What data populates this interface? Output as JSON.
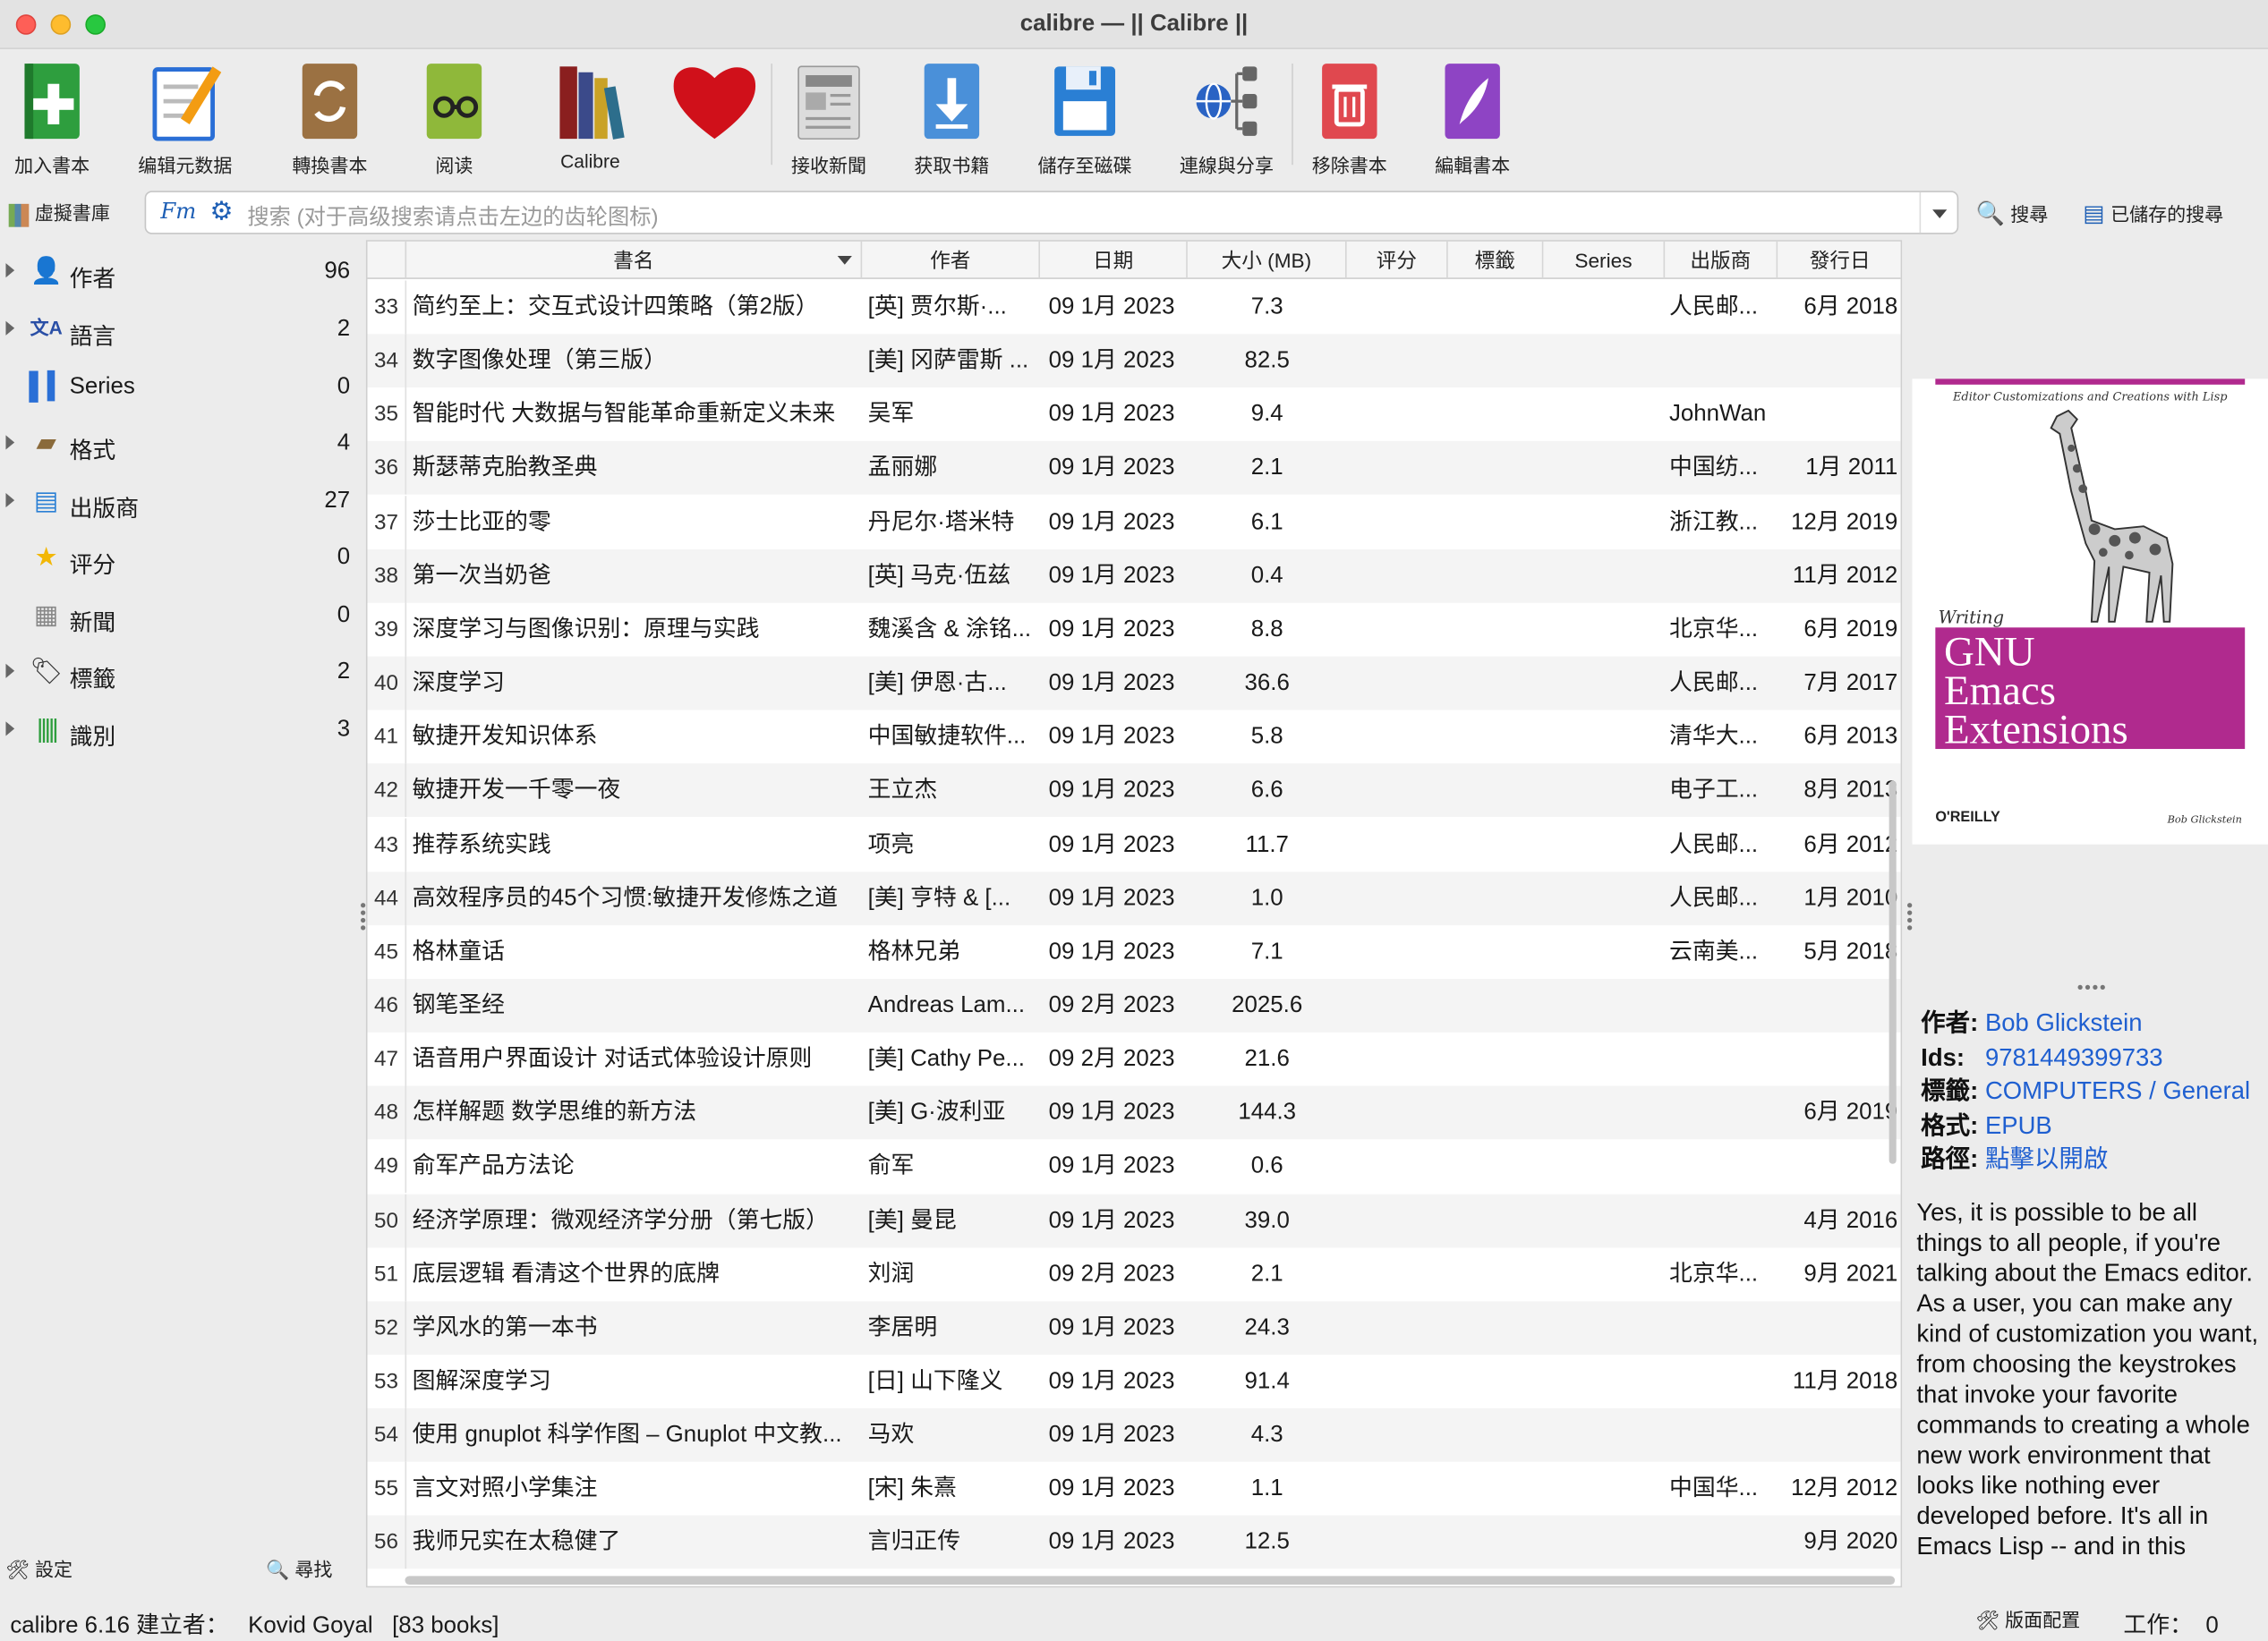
{
  "window": {
    "title": "calibre — || Calibre ||"
  },
  "toolbar": {
    "add": "加入書本",
    "edit_meta": "编辑元数据",
    "convert": "轉換書本",
    "read": "阅读",
    "calibre": "Calibre",
    "fetch_news": "接收新聞",
    "get_books": "获取书籍",
    "save": "儲存至磁碟",
    "connect": "連線與分享",
    "remove": "移除書本",
    "edit_book": "編輯書本"
  },
  "search": {
    "virtual_lib": "虛擬書庫",
    "placeholder": "搜索 (对于高级搜索请点击左边的齿轮图标)",
    "search_btn": "搜尋",
    "saved_btn": "已儲存的搜尋"
  },
  "sidebar": {
    "items": [
      {
        "label": "作者",
        "count": "96",
        "icon": "person-icon"
      },
      {
        "label": "語言",
        "count": "2",
        "icon": "language-icon"
      },
      {
        "label": "Series",
        "count": "0",
        "icon": "series-icon"
      },
      {
        "label": "格式",
        "count": "4",
        "icon": "format-icon"
      },
      {
        "label": "出版商",
        "count": "27",
        "icon": "publisher-icon"
      },
      {
        "label": "评分",
        "count": "0",
        "icon": "star-icon"
      },
      {
        "label": "新聞",
        "count": "0",
        "icon": "news-icon"
      },
      {
        "label": "標籤",
        "count": "2",
        "icon": "tag-icon"
      },
      {
        "label": "識別",
        "count": "3",
        "icon": "barcode-icon"
      }
    ],
    "settings": "設定",
    "find": "尋找"
  },
  "table": {
    "headers": [
      "書名",
      "作者",
      "日期",
      "大小 (MB)",
      "评分",
      "標籤",
      "Series",
      "出版商",
      "發行日"
    ],
    "rows": [
      [
        "33",
        "简约至上：交互式设计四策略（第2版）",
        "[英] 贾尔斯·...",
        "09 1月 2023",
        "7.3",
        "人民邮...",
        "6月 2018"
      ],
      [
        "34",
        "数字图像处理（第三版）",
        "[美] 冈萨雷斯 ...",
        "09 1月 2023",
        "82.5",
        "",
        ""
      ],
      [
        "35",
        "智能时代 大数据与智能革命重新定义未来",
        "吴军",
        "09 1月 2023",
        "9.4",
        "JohnWan",
        ""
      ],
      [
        "36",
        "斯瑟蒂克胎教圣典",
        "孟丽娜",
        "09 1月 2023",
        "2.1",
        "中国纺...",
        "1月 2011"
      ],
      [
        "37",
        "莎士比亚的零",
        "丹尼尔·塔米特",
        "09 1月 2023",
        "6.1",
        "浙江教...",
        "12月 2019"
      ],
      [
        "38",
        "第一次当奶爸",
        "[英] 马克·伍兹",
        "09 1月 2023",
        "0.4",
        "",
        "11月 2012"
      ],
      [
        "39",
        "深度学习与图像识别：原理与实践",
        "魏溪含 & 涂铭...",
        "09 1月 2023",
        "8.8",
        "北京华...",
        "6月 2019"
      ],
      [
        "40",
        "深度学习",
        "[美] 伊恩·古...",
        "09 1月 2023",
        "36.6",
        "人民邮...",
        "7月 2017"
      ],
      [
        "41",
        "敏捷开发知识体系",
        "中国敏捷软件...",
        "09 1月 2023",
        "5.8",
        "清华大...",
        "6月 2013"
      ],
      [
        "42",
        "敏捷开发一千零一夜",
        "王立杰",
        "09 1月 2023",
        "6.6",
        "电子工...",
        "8月 2013"
      ],
      [
        "43",
        "推荐系统实践",
        "项亮",
        "09 1月 2023",
        "11.7",
        "人民邮...",
        "6月 2012"
      ],
      [
        "44",
        "高效程序员的45个习惯:敏捷开发修炼之道",
        "[美] 亨特 & [...",
        "09 1月 2023",
        "1.0",
        "人民邮...",
        "1月 2010"
      ],
      [
        "45",
        "格林童话",
        "格林兄弟",
        "09 1月 2023",
        "7.1",
        "云南美...",
        "5月 2018"
      ],
      [
        "46",
        "钢笔圣经",
        "Andreas Lam...",
        "09 2月 2023",
        "2025.6",
        "",
        ""
      ],
      [
        "47",
        "语音用户界面设计 对话式体验设计原则",
        "[美] Cathy Pe...",
        "09 2月 2023",
        "21.6",
        "",
        ""
      ],
      [
        "48",
        "怎样解题 数学思维的新方法",
        "[美] G·波利亚",
        "09 1月 2023",
        "144.3",
        "",
        "6月 2019"
      ],
      [
        "49",
        "俞军产品方法论",
        "俞军",
        "09 1月 2023",
        "0.6",
        "",
        ""
      ],
      [
        "50",
        "经济学原理：微观经济学分册（第七版）",
        "[美] 曼昆",
        "09 1月 2023",
        "39.0",
        "",
        "4月 2016"
      ],
      [
        "51",
        "底层逻辑 看清这个世界的底牌",
        "刘润",
        "09 2月 2023",
        "2.1",
        "北京华...",
        "9月 2021"
      ],
      [
        "52",
        "学风水的第一本书",
        "李居明",
        "09 1月 2023",
        "24.3",
        "",
        ""
      ],
      [
        "53",
        "图解深度学习",
        "[日] 山下隆义",
        "09 1月 2023",
        "91.4",
        "",
        "11月 2018"
      ],
      [
        "54",
        "使用 gnuplot 科学作图 – Gnuplot 中文教...",
        "马欢",
        "09 1月 2023",
        "4.3",
        "",
        ""
      ],
      [
        "55",
        "言文对照小学集注",
        "[宋] 朱熹",
        "09 1月 2023",
        "1.1",
        "中国华...",
        "12月 2012"
      ],
      [
        "56",
        "我师兄实在太稳健了",
        "言归正传",
        "09 1月 2023",
        "12.5",
        "",
        "9月 2020"
      ]
    ]
  },
  "cover": {
    "subtitle": "Editor Customizations and Creations with Lisp",
    "writing": "Writing",
    "title_l1": "GNU",
    "title_l2": "Emacs",
    "title_l3": "Extensions",
    "publisher": "O'REILLY",
    "author": "Bob Glickstein"
  },
  "details": {
    "author_k": "作者:",
    "author_v": "Bob Glickstein",
    "ids_k": "Ids:",
    "ids_v": "9781449399733",
    "tags_k": "標籤:",
    "tags_v": "COMPUTERS / General",
    "format_k": "格式:",
    "format_v": "EPUB",
    "path_k": "路徑:",
    "path_v": "點擊以開啟",
    "description": "Yes, it is possible to be all things to all people, if you're talking about the Emacs editor. As a user, you can make any kind of customization you want, from choosing the keystrokes that invoke your favorite commands to creating a whole new work environment that looks like nothing ever developed before. It's all in Emacs Lisp -- and in this"
  },
  "status": {
    "left": "calibre 6.16 建立者：   Kovid Goyal   [83 books]",
    "layout": "版面配置",
    "jobs": "工作：  0"
  },
  "colors": {
    "accent": "#1f5fd0",
    "cover_band": "#b02a8e"
  }
}
